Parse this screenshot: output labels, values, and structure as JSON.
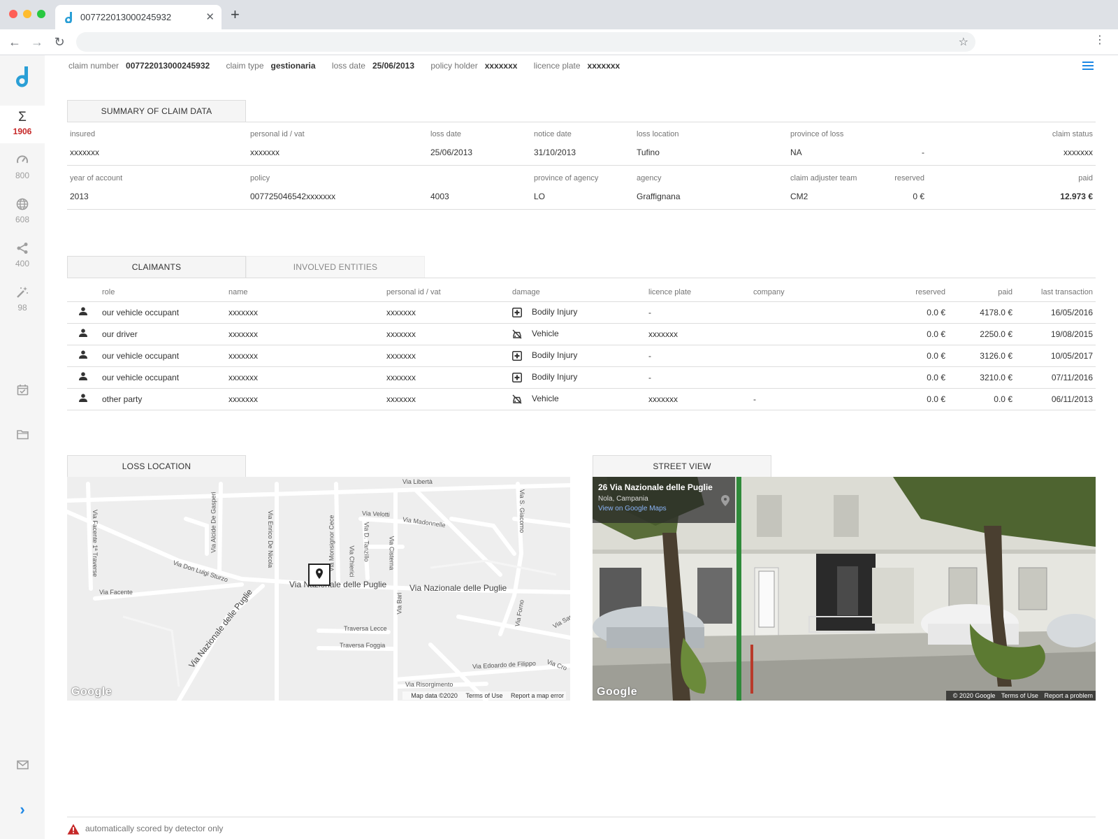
{
  "browser": {
    "tab_title": "007722013000245932",
    "close_glyph": "✕",
    "new_tab_glyph": "+",
    "back_glyph": "←",
    "forward_glyph": "→",
    "reload_glyph": "↻",
    "star_glyph": "☆",
    "menu_glyph": "⋮"
  },
  "sidebar": {
    "items": [
      {
        "icon": "sigma-icon",
        "glyph": "Σ",
        "count": "1906",
        "active": true
      },
      {
        "icon": "speedometer-icon",
        "count": "800"
      },
      {
        "icon": "globe-icon",
        "count": "608"
      },
      {
        "icon": "share-icon",
        "count": "400"
      },
      {
        "icon": "magic-wand-icon",
        "count": "98"
      }
    ],
    "bottom_icons": [
      "calendar-check-icon",
      "folder-icon",
      "mail-icon",
      "chevron-right-icon"
    ],
    "expand_glyph": "›"
  },
  "header": {
    "claim_number_label": "claim number",
    "claim_number": "007722013000245932",
    "claim_type_label": "claim type",
    "claim_type": "gestionaria",
    "loss_date_label": "loss date",
    "loss_date": "25/06/2013",
    "policy_holder_label": "policy holder",
    "policy_holder": "xxxxxxx",
    "licence_plate_label": "licence plate",
    "licence_plate": "xxxxxxx"
  },
  "summary": {
    "title": "SUMMARY OF CLAIM DATA",
    "row1_labels": [
      "insured",
      "personal id / vat",
      "loss date",
      "notice date",
      "loss location",
      "province of loss",
      "claim status"
    ],
    "row1_values": [
      "xxxxxxx",
      "xxxxxxx",
      "25/06/2013",
      "31/10/2013",
      "Tufino",
      "NA",
      "-",
      "xxxxxxx"
    ],
    "row2_labels": [
      "year of account",
      "policy",
      "province of agency",
      "agency",
      "claim adjuster team",
      "reserved",
      "paid"
    ],
    "row2_values": [
      "2013",
      "007725046542xxxxxxx",
      "4003",
      "LO",
      "Graffignana",
      "CM2",
      "0 €",
      "12.973 €"
    ]
  },
  "claimants": {
    "tab_active": "CLAIMANTS",
    "tab_inactive": "INVOLVED ENTITIES",
    "columns": [
      "role",
      "name",
      "personal id / vat",
      "damage",
      "licence plate",
      "company",
      "reserved",
      "paid",
      "last transaction"
    ],
    "rows": [
      {
        "role": "our vehicle occupant",
        "name": "xxxxxxx",
        "pid": "xxxxxxx",
        "damage_icon": "medical-cross-icon",
        "damage": "Bodily Injury",
        "plate": "-",
        "company": "",
        "reserved": "0.0 €",
        "paid": "4178.0 €",
        "last": "16/05/2016"
      },
      {
        "role": "our driver",
        "name": "xxxxxxx",
        "pid": "xxxxxxx",
        "damage_icon": "car-off-icon",
        "damage": "Vehicle",
        "plate": "xxxxxxx",
        "company": "",
        "reserved": "0.0 €",
        "paid": "2250.0 €",
        "last": "19/08/2015"
      },
      {
        "role": "our vehicle occupant",
        "name": "xxxxxxx",
        "pid": "xxxxxxx",
        "damage_icon": "medical-cross-icon",
        "damage": "Bodily Injury",
        "plate": "-",
        "company": "",
        "reserved": "0.0 €",
        "paid": "3126.0 €",
        "last": "10/05/2017"
      },
      {
        "role": "our vehicle occupant",
        "name": "xxxxxxx",
        "pid": "xxxxxxx",
        "damage_icon": "medical-cross-icon",
        "damage": "Bodily Injury",
        "plate": "-",
        "company": "",
        "reserved": "0.0 €",
        "paid": "3210.0 €",
        "last": "07/11/2016"
      },
      {
        "role": "other party",
        "name": "xxxxxxx",
        "pid": "xxxxxxx",
        "damage_icon": "car-off-icon",
        "damage": "Vehicle",
        "plate": "xxxxxxx",
        "company": "-",
        "reserved": "0.0 €",
        "paid": "0.0 €",
        "last": "06/11/2013"
      }
    ]
  },
  "loss_location": {
    "title": "LOSS LOCATION",
    "streets": [
      "Via Libertà",
      "Via Velotti",
      "Via Madonnelle",
      "Via S. Giacomo",
      "Via Facente 1ª Traverse",
      "Via Alcide De Gasperi",
      "Via Enrico De Nicola",
      "Via Monsignor Cece",
      "Via D. Tanzillo",
      "Via Chierici",
      "Via Cisterna",
      "Via Don Luigi Sturzo",
      "Via Facente",
      "Via Nazionale delle Puglie",
      "Via Nazionale delle Puglie",
      "Via Nazionale delle Puglie",
      "Via Bari",
      "Via Forno",
      "Via Sar",
      "Traversa Lecce",
      "Traversa Foggia",
      "Via Edoardo de Filippo",
      "Via Cro",
      "Via Risorgimento"
    ],
    "google": "Google",
    "map_data": "Map data ©2020",
    "terms": "Terms of Use",
    "report": "Report a map error"
  },
  "street_view": {
    "title": "STREET VIEW",
    "address": "26 Via Nazionale delle Puglie",
    "city": "Nola, Campania",
    "link": "View on Google Maps",
    "google": "Google",
    "copyright": "© 2020 Google",
    "terms": "Terms of Use",
    "report": "Report a problem"
  },
  "footer": {
    "warning": "automatically scored by detector only"
  },
  "colors": {
    "accent_blue": "#1e88e5",
    "alert_red": "#c62828",
    "logo_blue": "#2a9fd6"
  }
}
